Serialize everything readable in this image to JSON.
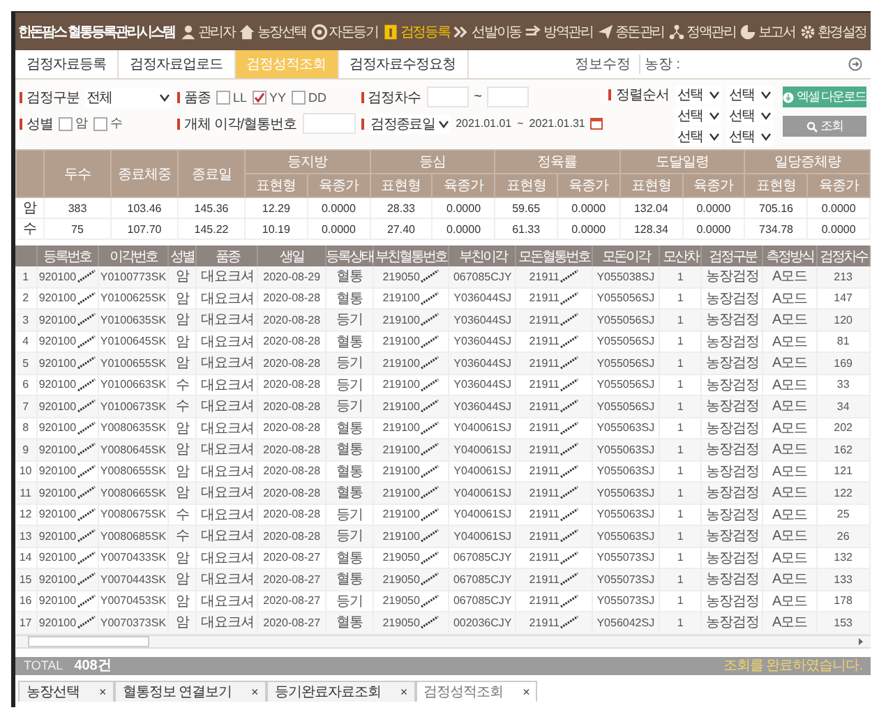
{
  "app_title": "한돈팜스 혈통등록관리시스템",
  "nav": [
    {
      "label": "관리자",
      "selected": false
    },
    {
      "label": "농장선택",
      "selected": false
    },
    {
      "label": "자돈등기",
      "selected": false
    },
    {
      "label": "검정등록",
      "selected": true
    },
    {
      "label": "선발이동",
      "selected": false
    },
    {
      "label": "방역관리",
      "selected": false
    },
    {
      "label": "종돈관리",
      "selected": false
    },
    {
      "label": "정액관리",
      "selected": false
    },
    {
      "label": "보고서",
      "selected": false
    },
    {
      "label": "환경설정",
      "selected": false
    }
  ],
  "subtabs": [
    {
      "label": "검정자료등록",
      "selected": false
    },
    {
      "label": "검정자료업로드",
      "selected": false
    },
    {
      "label": "검정성적조회",
      "selected": true
    },
    {
      "label": "검정자료수정요청",
      "selected": false
    }
  ],
  "account": {
    "edit_link": "정보수정",
    "farm_label": "농장 :"
  },
  "filters": {
    "test_type": {
      "label": "검정구분",
      "value": "전체"
    },
    "breed": {
      "label": "품종",
      "options": [
        {
          "label": "LL",
          "checked": false
        },
        {
          "label": "YY",
          "checked": true
        },
        {
          "label": "DD",
          "checked": false
        }
      ]
    },
    "test_round": {
      "label": "검정차수",
      "separator": "~"
    },
    "sort": {
      "label": "정렬순서",
      "selects": [
        [
          "선택",
          "선택"
        ],
        [
          "선택",
          "선택"
        ],
        [
          "선택",
          "선택"
        ]
      ]
    },
    "sex": {
      "label": "성별",
      "options": [
        {
          "label": "암",
          "checked": false
        },
        {
          "label": "수",
          "checked": false
        }
      ]
    },
    "id_search": {
      "label": "개체 이각/혈통번호"
    },
    "date": {
      "type": "검정종료일",
      "from": "2021.01.01",
      "separator": "~",
      "to": "2021.01.31"
    }
  },
  "buttons": {
    "excel": "엑셀 다운로드",
    "search": "조회"
  },
  "summary": {
    "lead_columns": [
      "두수",
      "종료체중",
      "종료일"
    ],
    "groups": [
      {
        "label": "등지방",
        "sub": [
          "표현형",
          "육종가"
        ]
      },
      {
        "label": "등심",
        "sub": [
          "표현형",
          "육종가"
        ]
      },
      {
        "label": "정육률",
        "sub": [
          "표현형",
          "육종가"
        ]
      },
      {
        "label": "도달일령",
        "sub": [
          "표현형",
          "육종가"
        ]
      },
      {
        "label": "일당증체량",
        "sub": [
          "표현형",
          "육종가"
        ]
      }
    ],
    "rows": [
      {
        "label": "암",
        "cells": [
          "383",
          "103.46",
          "145.36",
          "12.29",
          "0.0000",
          "28.33",
          "0.0000",
          "59.65",
          "0.0000",
          "132.04",
          "0.0000",
          "705.16",
          "0.0000"
        ]
      },
      {
        "label": "수",
        "cells": [
          "75",
          "107.70",
          "145.22",
          "10.19",
          "0.0000",
          "27.40",
          "0.0000",
          "61.33",
          "0.0000",
          "128.34",
          "0.0000",
          "734.78",
          "0.0000"
        ]
      }
    ]
  },
  "grid": {
    "columns": [
      {
        "label": "등록번호",
        "masked": true
      },
      {
        "label": "이각번호",
        "masked": false
      },
      {
        "label": "성별",
        "masked": false
      },
      {
        "label": "품종",
        "masked": false
      },
      {
        "label": "생일",
        "masked": false
      },
      {
        "label": "등록상태",
        "masked": false
      },
      {
        "label": "부친혈통번호",
        "masked": true
      },
      {
        "label": "부친이각",
        "masked": false
      },
      {
        "label": "모돈혈통번호",
        "masked": true
      },
      {
        "label": "모돈이각",
        "masked": false
      },
      {
        "label": "모산차",
        "masked": false
      },
      {
        "label": "검정구분",
        "masked": false
      },
      {
        "label": "측정방식",
        "masked": false
      },
      {
        "label": "검정차수",
        "masked": false
      }
    ],
    "rows": [
      {
        "no": "1",
        "cells": [
          "920100",
          "Y0100773SK",
          "암",
          "대요크셔",
          "2020-08-29",
          "혈통",
          "219050",
          "067085CJY",
          "21911",
          "Y055038SJ",
          "1",
          "농장검정",
          "A모드",
          "213"
        ]
      },
      {
        "no": "2",
        "cells": [
          "920100",
          "Y0100625SK",
          "암",
          "대요크셔",
          "2020-08-28",
          "혈통",
          "219100",
          "Y036044SJ",
          "21911",
          "Y055056SJ",
          "1",
          "농장검정",
          "A모드",
          "147"
        ]
      },
      {
        "no": "3",
        "cells": [
          "920100",
          "Y0100635SK",
          "암",
          "대요크셔",
          "2020-08-28",
          "등기",
          "219100",
          "Y036044SJ",
          "21911",
          "Y055056SJ",
          "1",
          "농장검정",
          "A모드",
          "120"
        ]
      },
      {
        "no": "4",
        "cells": [
          "920100",
          "Y0100645SK",
          "암",
          "대요크셔",
          "2020-08-28",
          "혈통",
          "219100",
          "Y036044SJ",
          "21911",
          "Y055056SJ",
          "1",
          "농장검정",
          "A모드",
          "81"
        ]
      },
      {
        "no": "5",
        "cells": [
          "920100",
          "Y0100655SK",
          "암",
          "대요크셔",
          "2020-08-28",
          "등기",
          "219100",
          "Y036044SJ",
          "21911",
          "Y055056SJ",
          "1",
          "농장검정",
          "A모드",
          "169"
        ]
      },
      {
        "no": "6",
        "cells": [
          "920100",
          "Y0100663SK",
          "수",
          "대요크셔",
          "2020-08-28",
          "등기",
          "219100",
          "Y036044SJ",
          "21911",
          "Y055056SJ",
          "1",
          "농장검정",
          "A모드",
          "33"
        ]
      },
      {
        "no": "7",
        "cells": [
          "920100",
          "Y0100673SK",
          "수",
          "대요크셔",
          "2020-08-28",
          "등기",
          "219100",
          "Y036044SJ",
          "21911",
          "Y055056SJ",
          "1",
          "농장검정",
          "A모드",
          "34"
        ]
      },
      {
        "no": "8",
        "cells": [
          "920100",
          "Y0080635SK",
          "암",
          "대요크셔",
          "2020-08-28",
          "혈통",
          "219100",
          "Y040061SJ",
          "21911",
          "Y055063SJ",
          "1",
          "농장검정",
          "A모드",
          "202"
        ]
      },
      {
        "no": "9",
        "cells": [
          "920100",
          "Y0080645SK",
          "암",
          "대요크셔",
          "2020-08-28",
          "혈통",
          "219100",
          "Y040061SJ",
          "21911",
          "Y055063SJ",
          "1",
          "농장검정",
          "A모드",
          "162"
        ]
      },
      {
        "no": "10",
        "cells": [
          "920100",
          "Y0080655SK",
          "암",
          "대요크셔",
          "2020-08-28",
          "혈통",
          "219100",
          "Y040061SJ",
          "21911",
          "Y055063SJ",
          "1",
          "농장검정",
          "A모드",
          "121"
        ]
      },
      {
        "no": "11",
        "cells": [
          "920100",
          "Y0080665SK",
          "암",
          "대요크셔",
          "2020-08-28",
          "혈통",
          "219100",
          "Y040061SJ",
          "21911",
          "Y055063SJ",
          "1",
          "농장검정",
          "A모드",
          "122"
        ]
      },
      {
        "no": "12",
        "cells": [
          "920100",
          "Y0080675SK",
          "수",
          "대요크셔",
          "2020-08-28",
          "등기",
          "219100",
          "Y040061SJ",
          "21911",
          "Y055063SJ",
          "1",
          "농장검정",
          "A모드",
          "25"
        ]
      },
      {
        "no": "13",
        "cells": [
          "920100",
          "Y0080685SK",
          "수",
          "대요크셔",
          "2020-08-28",
          "등기",
          "219100",
          "Y040061SJ",
          "21911",
          "Y055063SJ",
          "1",
          "농장검정",
          "A모드",
          "26"
        ]
      },
      {
        "no": "14",
        "cells": [
          "920100",
          "Y0070433SK",
          "암",
          "대요크셔",
          "2020-08-27",
          "혈통",
          "219050",
          "067085CJY",
          "21911",
          "Y055073SJ",
          "1",
          "농장검정",
          "A모드",
          "132"
        ]
      },
      {
        "no": "15",
        "cells": [
          "920100",
          "Y0070443SK",
          "암",
          "대요크셔",
          "2020-08-27",
          "혈통",
          "219050",
          "067085CJY",
          "21911",
          "Y055073SJ",
          "1",
          "농장검정",
          "A모드",
          "133"
        ]
      },
      {
        "no": "16",
        "cells": [
          "920100",
          "Y0070453SK",
          "암",
          "대요크셔",
          "2020-08-27",
          "등기",
          "219050",
          "067085CJY",
          "21911",
          "Y055073SJ",
          "1",
          "농장검정",
          "A모드",
          "178"
        ]
      },
      {
        "no": "17",
        "cells": [
          "920100",
          "Y0070373SK",
          "암",
          "대요크셔",
          "2020-08-27",
          "혈통",
          "219050",
          "002036CJY",
          "21911",
          "Y056042SJ",
          "1",
          "농장검정",
          "A모드",
          "153"
        ]
      }
    ]
  },
  "total": {
    "label": "TOTAL",
    "count": "408건",
    "message": "조회를 완료하였습니다."
  },
  "bottom_tabs": [
    {
      "label": "농장선택",
      "close": "×",
      "selected": false
    },
    {
      "label": "혈통정보 연결보기",
      "close": "×",
      "selected": false
    },
    {
      "label": "등기완료자료조회",
      "close": "×",
      "selected": false
    },
    {
      "label": "검정성적조회",
      "close": "×",
      "selected": true
    }
  ]
}
